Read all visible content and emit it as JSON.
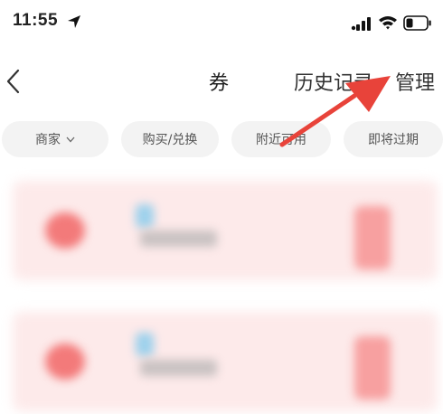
{
  "status": {
    "time": "11:55",
    "icons": [
      "location-arrow-icon",
      "signal-icon",
      "wifi-icon",
      "battery-icon"
    ]
  },
  "nav": {
    "back_icon": "chevron-left-icon",
    "title": "券",
    "history": "历史记录",
    "manage": "管理"
  },
  "filters": [
    {
      "label": "商家",
      "has_dropdown": true
    },
    {
      "label": "购买/兑换"
    },
    {
      "label": "附近可用"
    },
    {
      "label": "即将过期"
    }
  ],
  "annotation": {
    "color": "#e8433a",
    "icon": "red-arrow-annotation"
  },
  "colors": {
    "card_bg": "#fdeaea",
    "accent": "#f06060"
  }
}
